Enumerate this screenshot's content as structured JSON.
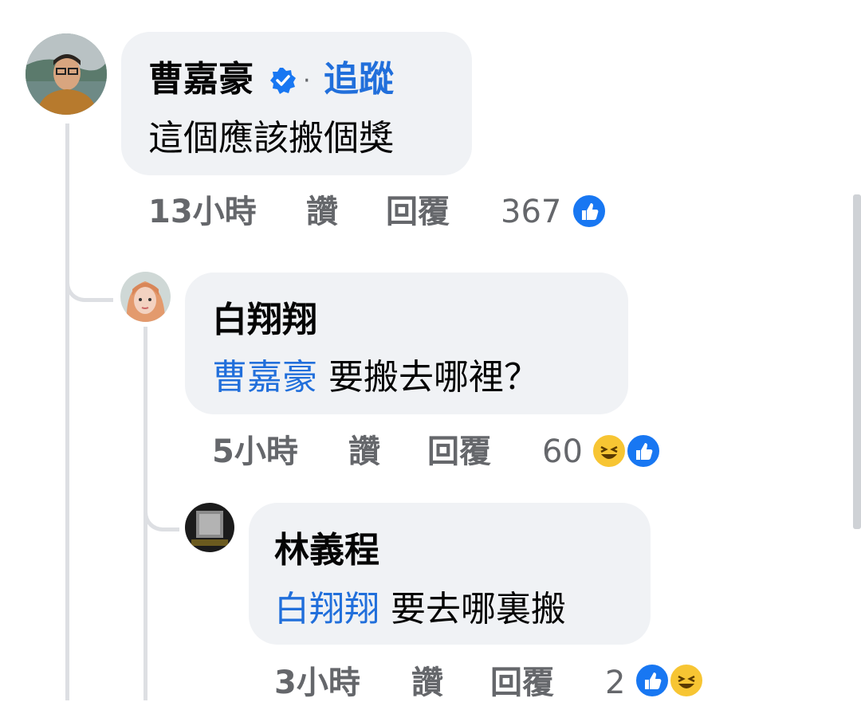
{
  "comments": [
    {
      "author": "曹嘉豪",
      "verified": true,
      "separator": "·",
      "follow_label": "追蹤",
      "mention": "",
      "text": "這個應該搬個獎",
      "time": "13小時",
      "like_label": "讚",
      "reply_label": "回覆",
      "reaction_count": "367",
      "reactions": [
        "like-icon"
      ]
    },
    {
      "author": "白翔翔",
      "mention": "曹嘉豪",
      "text": "要搬去哪裡？",
      "time": "5小時",
      "like_label": "讚",
      "reply_label": "回覆",
      "reaction_count": "60",
      "reactions": [
        "haha-icon",
        "like-icon"
      ]
    },
    {
      "author": "林義程",
      "mention": "白翔翔",
      "text": "要去哪裏搬",
      "time": "3小時",
      "like_label": "讚",
      "reply_label": "回覆",
      "reaction_count": "2",
      "reactions": [
        "like-icon",
        "haha-icon"
      ]
    }
  ],
  "colors": {
    "bubble": "#f0f2f5",
    "mention": "#216fdb",
    "meta": "#65676b",
    "like": "#1877f2",
    "haha": "#f7c533"
  }
}
